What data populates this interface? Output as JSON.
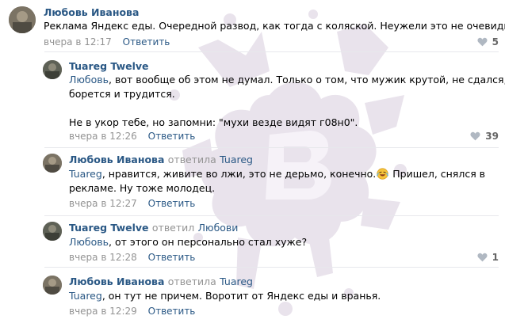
{
  "comments": [
    {
      "author": "Любовь Иванова",
      "text": "Реклама Яндекс еды. Очередной развод, как тогда с коляской. Неужели это не очевидно?",
      "time": "вчера в 12:17",
      "reply_label": "Ответить",
      "likes": "5"
    },
    {
      "author": "Tuareg Twelve",
      "mention": "Любовь",
      "text_line1": ", вот вообще об этом не думал. Только о том, что мужик крутой, не сдался,",
      "text_line2": "борется и трудится.",
      "text_line3": "Не в укор тебе, но запомни: \"мухи везде видят г08н0\".",
      "time": "вчера в 12:26",
      "reply_label": "Ответить",
      "likes": "39"
    },
    {
      "author": "Любовь Иванова",
      "verb": "ответила",
      "target": "Tuareg",
      "mention": "Tuareg",
      "text_line1_a": ", нравится, живите во лжи, это не дерьмо, конечно.",
      "text_line1_b": " Пришел, снялся в",
      "text_line2": "рекламе. Ну тоже молодец.",
      "time": "вчера в 12:27",
      "reply_label": "Ответить"
    },
    {
      "author": "Tuareg Twelve",
      "verb": "ответил",
      "target": "Любови",
      "mention": "Любовь",
      "text_line1": ", от этого он персонально стал хуже?",
      "time": "вчера в 12:28",
      "reply_label": "Ответить",
      "likes": "1"
    },
    {
      "author": "Любовь Иванова",
      "verb": "ответила",
      "target": "Tuareg",
      "mention": "Tuareg",
      "text_line1": ", он тут не причем. Воротит от Яндекс еды и вранья.",
      "time": "вчера в 12:29",
      "reply_label": "Ответить"
    }
  ],
  "colors": {
    "link": "#2a5885",
    "meta": "#939393",
    "watermark": "#e9e3ec"
  }
}
